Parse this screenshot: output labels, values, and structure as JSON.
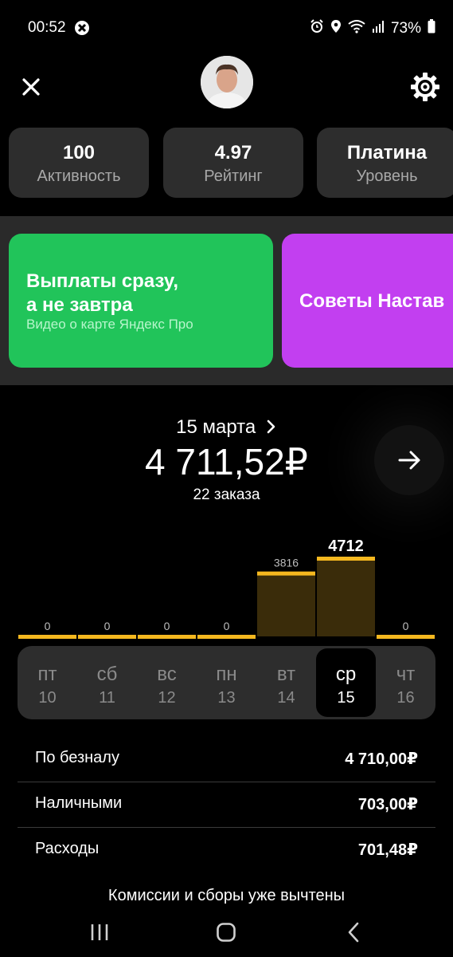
{
  "status_bar": {
    "time": "00:52",
    "battery": "73%"
  },
  "stats": [
    {
      "value": "100",
      "label": "Активность"
    },
    {
      "value": "4.97",
      "label": "Рейтинг"
    },
    {
      "value": "Платина",
      "label": "Уровень"
    }
  ],
  "promos": [
    {
      "title_line1": "Выплаты сразу,",
      "title_line2": "а не завтра",
      "subtitle": "Видео о карте Яндекс Про",
      "color": "#21c45a"
    },
    {
      "title": "Советы Настав",
      "color": "#c23ff0"
    }
  ],
  "summary": {
    "date": "15 марта",
    "total": "4 711,52₽",
    "orders": "22 заказа"
  },
  "chart_data": {
    "type": "bar",
    "categories": [
      "пт 10",
      "сб 11",
      "вс 12",
      "пн 13",
      "вт 14",
      "ср 15",
      "чт 16"
    ],
    "values": [
      0,
      0,
      0,
      0,
      3816,
      4712,
      0
    ],
    "value_labels": [
      "0",
      "0",
      "0",
      "0",
      "3816",
      "4712",
      "0"
    ],
    "selected_index": 5,
    "bar_color": "#f5b81f",
    "fill_color": "#3a2c0a"
  },
  "days": [
    {
      "name": "пт",
      "date": "10"
    },
    {
      "name": "сб",
      "date": "11"
    },
    {
      "name": "вс",
      "date": "12"
    },
    {
      "name": "пн",
      "date": "13"
    },
    {
      "name": "вт",
      "date": "14"
    },
    {
      "name": "ср",
      "date": "15"
    },
    {
      "name": "чт",
      "date": "16"
    }
  ],
  "breakdown": [
    {
      "label": "По безналу",
      "value": "4 710,00₽"
    },
    {
      "label": "Наличными",
      "value": "703,00₽"
    },
    {
      "label": "Расходы",
      "value": "701,48₽"
    }
  ],
  "note": "Комиссии и сборы уже вычтены"
}
